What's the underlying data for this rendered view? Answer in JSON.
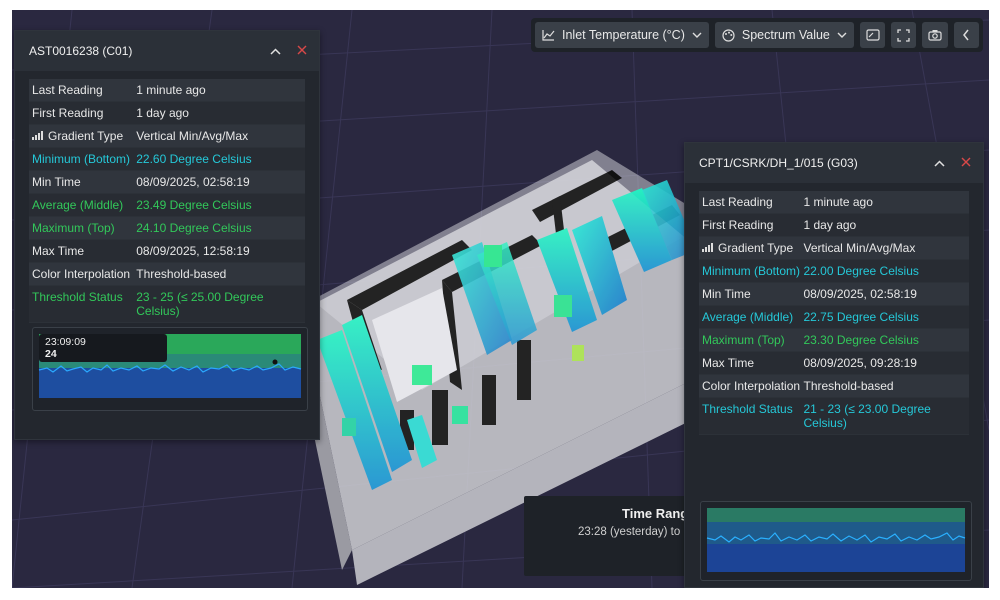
{
  "toolbar": {
    "metric_select": "Inlet Temperature (°C)",
    "color_select": "Spectrum Value"
  },
  "panel_left": {
    "title": "AST0016238 (C01)",
    "rows": [
      {
        "key": "Last Reading",
        "value": "1 minute ago",
        "color": "white"
      },
      {
        "key": "First Reading",
        "value": "1 day ago",
        "color": "white"
      },
      {
        "key": "Gradient Type",
        "value": "Vertical Min/Avg/Max",
        "color": "white",
        "icon": "bar-chart-icon"
      },
      {
        "key": "Minimum (Bottom)",
        "value": "22.60 Degree Celsius",
        "color": "cyan"
      },
      {
        "key": "Min Time",
        "value": "08/09/2025, 02:58:19",
        "color": "white"
      },
      {
        "key": "Average (Middle)",
        "value": "23.49 Degree Celsius",
        "color": "green"
      },
      {
        "key": "Maximum (Top)",
        "value": "24.10 Degree Celsius",
        "color": "green"
      },
      {
        "key": "Max Time",
        "value": "08/09/2025, 12:58:19",
        "color": "white"
      },
      {
        "key": "Color Interpolation",
        "value": "Threshold-based",
        "color": "white"
      },
      {
        "key": "Threshold Status",
        "value": "23 - 25 (≤ 25.00 Degree Celsius)",
        "color": "green"
      }
    ],
    "tooltip": {
      "time": "23:09:09",
      "value": "24"
    }
  },
  "panel_right": {
    "title": "CPT1/CSRK/DH_1/015 (G03)",
    "rows": [
      {
        "key": "Last Reading",
        "value": "1 minute ago",
        "color": "white"
      },
      {
        "key": "First Reading",
        "value": "1 day ago",
        "color": "white"
      },
      {
        "key": "Gradient Type",
        "value": "Vertical Min/Avg/Max",
        "color": "white",
        "icon": "bar-chart-icon"
      },
      {
        "key": "Minimum (Bottom)",
        "value": "22.00 Degree Celsius",
        "color": "cyan"
      },
      {
        "key": "Min Time",
        "value": "08/09/2025, 02:58:19",
        "color": "white"
      },
      {
        "key": "Average (Middle)",
        "value": "22.75 Degree Celsius",
        "color": "cyan"
      },
      {
        "key": "Maximum (Top)",
        "value": "23.30 Degree Celsius",
        "color": "green"
      },
      {
        "key": "Max Time",
        "value": "08/09/2025, 09:28:19",
        "color": "white"
      },
      {
        "key": "Color Interpolation",
        "value": "Threshold-based",
        "color": "white"
      },
      {
        "key": "Threshold Status",
        "value": "21 - 23 (≤ 23.00 Degree Celsius)",
        "color": "cyan"
      }
    ]
  },
  "time_range": {
    "title": "Time Rang",
    "subtitle": "23:28 (yesterday) to"
  },
  "colors": {
    "background": "#2a2840",
    "panel": "#23272e",
    "cyan": "#25c8d8",
    "green": "#32c85a",
    "rack_glow": "#1de0c8"
  }
}
